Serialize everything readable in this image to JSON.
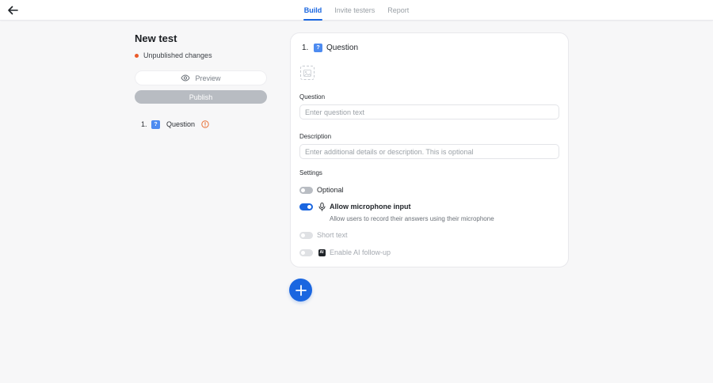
{
  "nav": {
    "tabs": [
      {
        "label": "Build",
        "active": true
      },
      {
        "label": "Invite testers",
        "active": false
      },
      {
        "label": "Report",
        "active": false
      }
    ]
  },
  "sidebar": {
    "title": "New test",
    "status": "Unpublished changes",
    "preview_label": "Preview",
    "publish_label": "Publish",
    "questions": [
      {
        "number": "1.",
        "icon_glyph": "?",
        "label": "Question",
        "warning": true
      }
    ]
  },
  "card": {
    "number": "1.",
    "icon_glyph": "?",
    "title": "Question",
    "question_label": "Question",
    "question_placeholder": "Enter question text",
    "question_value": "",
    "description_label": "Description",
    "description_placeholder": "Enter additional details or description. This is optional",
    "description_value": "",
    "settings_label": "Settings",
    "settings": {
      "optional": {
        "label": "Optional",
        "on": false
      },
      "microphone": {
        "label": "Allow microphone input",
        "on": true,
        "sub": "Allow users to record their answers using their microphone"
      },
      "short_text": {
        "label": "Short text",
        "on": false,
        "disabled": true
      },
      "ai_followup": {
        "label": "Enable AI follow-up",
        "on": false,
        "disabled": true,
        "badge": "AI"
      }
    }
  },
  "colors": {
    "accent": "#1a66e0",
    "status_dot": "#ea5a2a",
    "publish_disabled": "#b8bcc2",
    "warning": "#e8743b"
  },
  "icons": {
    "back": "arrow-left-icon",
    "preview": "eye-icon",
    "question": "question-mark-icon",
    "warning": "warning-circle-icon",
    "image": "image-placeholder-icon",
    "microphone": "microphone-icon",
    "add": "plus-icon"
  }
}
